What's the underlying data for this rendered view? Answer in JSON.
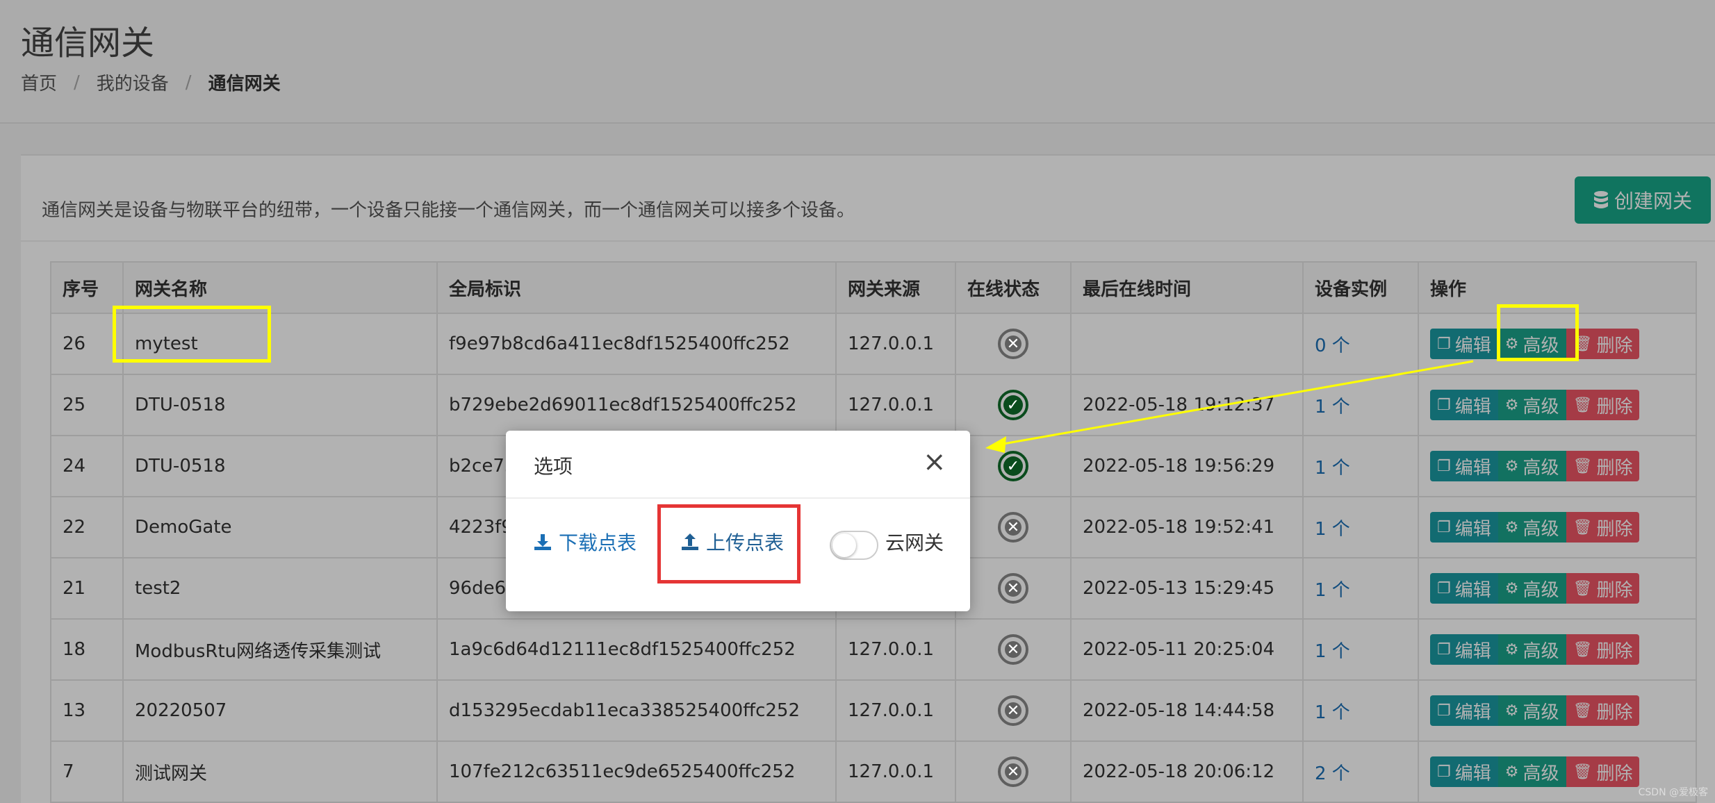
{
  "header": {
    "title": "通信网关"
  },
  "breadcrumb": {
    "home": "首页",
    "devices": "我的设备",
    "current": "通信网关",
    "sep": "/"
  },
  "panel": {
    "description": "通信网关是设备与物联平台的纽带，一个设备只能接一个通信网关，而一个通信网关可以接多个设备。",
    "create_label": "创建网关"
  },
  "table": {
    "columns": [
      "序号",
      "网关名称",
      "全局标识",
      "网关来源",
      "在线状态",
      "最后在线时间",
      "设备实例",
      "操作"
    ],
    "rows": [
      {
        "id": "26",
        "name": "mytest",
        "uid": "f9e97b8cd6a411ec8df1525400ffc252",
        "source": "127.0.0.1",
        "online": false,
        "last": "",
        "instances": "0 个"
      },
      {
        "id": "25",
        "name": "DTU-0518",
        "uid": "b729ebe2d69011ec8df1525400ffc252",
        "source": "127.0.0.1",
        "online": true,
        "last": "2022-05-18 19:12:37",
        "instances": "1 个"
      },
      {
        "id": "24",
        "name": "DTU-0518",
        "uid": "b2ce75",
        "source": "",
        "online": true,
        "last": "2022-05-18 19:56:29",
        "instances": "1 个"
      },
      {
        "id": "22",
        "name": "DemoGate",
        "uid": "4223f9",
        "source": "",
        "online": false,
        "last": "2022-05-18 19:52:41",
        "instances": "1 个"
      },
      {
        "id": "21",
        "name": "test2",
        "uid": "96de6e",
        "source": "",
        "online": false,
        "last": "2022-05-13 15:29:45",
        "instances": "1 个"
      },
      {
        "id": "18",
        "name": "ModbusRtu网络透传采集测试",
        "uid": "1a9c6d64d12111ec8df1525400ffc252",
        "source": "127.0.0.1",
        "online": false,
        "last": "2022-05-11 20:25:04",
        "instances": "1 个"
      },
      {
        "id": "13",
        "name": "20220507",
        "uid": "d153295ecdab11eca338525400ffc252",
        "source": "127.0.0.1",
        "online": false,
        "last": "2022-05-18 14:44:58",
        "instances": "1 个"
      },
      {
        "id": "7",
        "name": "测试网关",
        "uid": "107fe212c63511ec9de6525400ffc252",
        "source": "127.0.0.1",
        "online": false,
        "last": "2022-05-18 20:06:12",
        "instances": "2 个"
      }
    ],
    "ops": {
      "edit": "编辑",
      "advanced": "高级",
      "delete": "删除"
    }
  },
  "modal": {
    "title": "选项",
    "close": "×",
    "download_label": "下载点表",
    "upload_label": "上传点表",
    "cloud_label": "云网关",
    "cloud_enabled": false
  },
  "watermark": "CSDN @爱极客",
  "colors": {
    "create": "#18a689",
    "edit": "#1a9aa3",
    "advanced": "#1ba28a",
    "delete": "#ed5565",
    "highlight_yellow": "#ffff00",
    "highlight_red": "#e53535",
    "link": "#1b6fb5"
  }
}
